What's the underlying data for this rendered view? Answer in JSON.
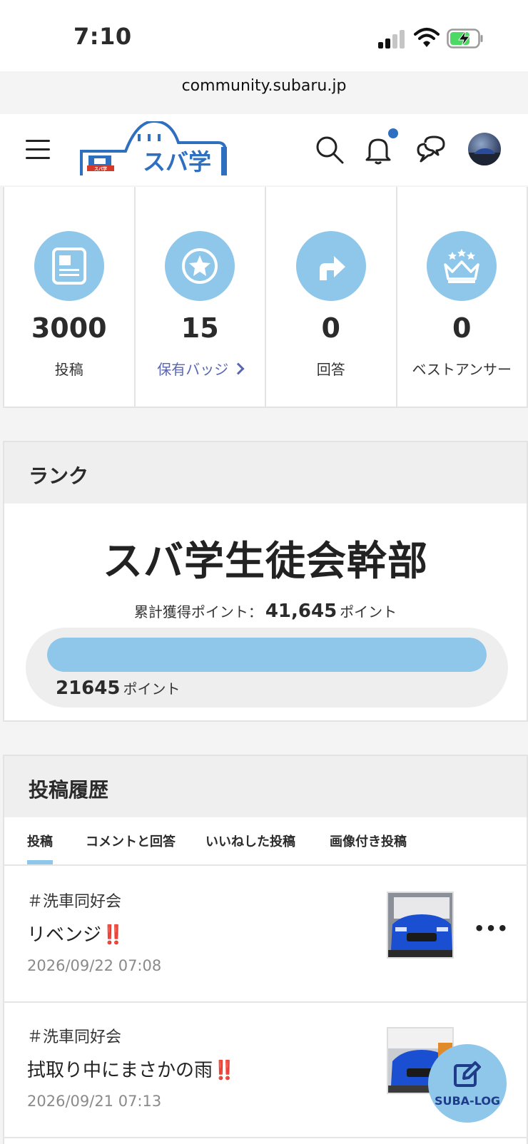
{
  "status_bar": {
    "time": "7:10"
  },
  "browser": {
    "url": "community.subaru.jp"
  },
  "header": {
    "logo_text": "スバ学",
    "logo_badge_text": "スバ学"
  },
  "stats": [
    {
      "icon": "article-icon",
      "value": "3000",
      "label": "投稿"
    },
    {
      "icon": "star-badge-icon",
      "value": "15",
      "label": "保有バッジ"
    },
    {
      "icon": "reply-arrow-icon",
      "value": "0",
      "label": "回答"
    },
    {
      "icon": "crown-icon",
      "value": "0",
      "label": "ベストアンサー"
    }
  ],
  "rank": {
    "section_title": "ランク",
    "rank_name": "スバ学生徒会幹部",
    "total_label": "累計獲得ポイント：",
    "total_points": "41,645",
    "points_unit": "ポイント",
    "progress_points": "21645",
    "progress_fraction": 1.0
  },
  "history": {
    "section_title": "投稿履歴",
    "tabs": [
      {
        "label": "投稿",
        "active": true
      },
      {
        "label": "コメントと回答"
      },
      {
        "label": "いいねした投稿"
      },
      {
        "label": "画像付き投稿"
      }
    ],
    "posts": [
      {
        "tag": "＃洗車同好会",
        "title": "リベンジ",
        "emoji": "‼️",
        "date": "2026/09/22 07:08"
      },
      {
        "tag": "＃洗車同好会",
        "title": "拭取り中にまさかの雨",
        "emoji": "‼️",
        "date": "2026/09/21 07:13"
      }
    ],
    "more_label": "•••"
  },
  "fab": {
    "label": "SUBA-LOG"
  },
  "colors": {
    "accent": "#8ec7ea",
    "link": "#5a66b0",
    "brand_blue": "#2f6fbf",
    "warning": "#d23a2a"
  }
}
